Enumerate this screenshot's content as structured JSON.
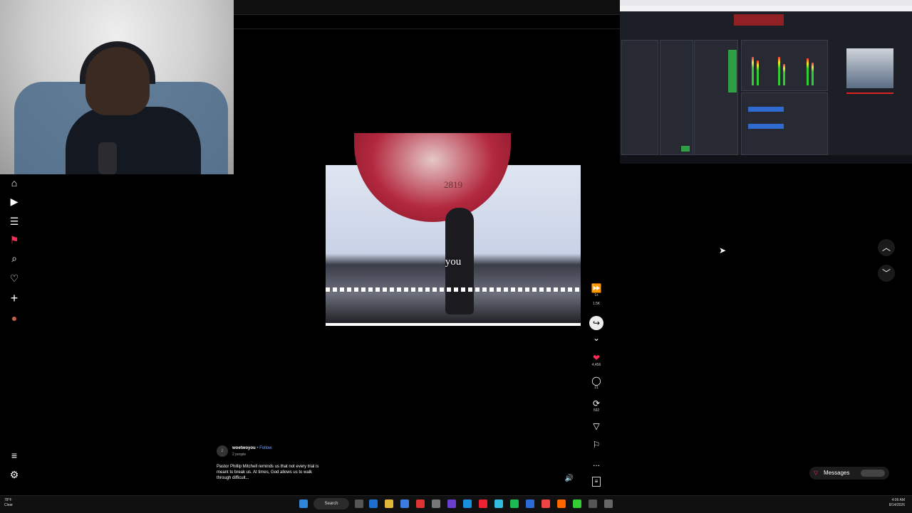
{
  "webcam": {
    "label": "Streamer webcam"
  },
  "left_nav": {
    "items": [
      {
        "name": "home-icon",
        "glyph": "⌂"
      },
      {
        "name": "play-icon",
        "glyph": "▶"
      },
      {
        "name": "subscriptions-icon",
        "glyph": "☰"
      },
      {
        "name": "notifications-icon",
        "glyph": "⚑"
      },
      {
        "name": "search-icon",
        "glyph": "⌕"
      },
      {
        "name": "favorites-icon",
        "glyph": "♡"
      },
      {
        "name": "create-icon",
        "glyph": "+"
      },
      {
        "name": "profile-avatar-icon",
        "glyph": "●"
      }
    ],
    "bottom_items": [
      {
        "name": "menu-icon",
        "glyph": "≡"
      },
      {
        "name": "apps-icon",
        "glyph": "⚙"
      }
    ]
  },
  "video": {
    "caption": "you",
    "seal_text": "2819"
  },
  "actions": {
    "speed_label": "1x",
    "views": "1.5K",
    "likes": "4,456",
    "comments": "21",
    "reposts": "592",
    "more": "..."
  },
  "post": {
    "username": "woetwoyou",
    "follow": "• Follow",
    "people": "2 people",
    "description": "Pastor Phillip Mitchell reminds us that not every trial is meant to break us. At times, God allows us to walk through difficult..."
  },
  "messages": {
    "label": "Messages"
  },
  "taskbar": {
    "weather_temp": "78°F",
    "weather_desc": "Clear",
    "search_label": "Search",
    "time": "4:06 AM",
    "date": "8/14/2026"
  },
  "colors": {
    "accent": "#ff2c55",
    "link": "#7ea7ff",
    "obs_bg": "#1d1f26"
  }
}
